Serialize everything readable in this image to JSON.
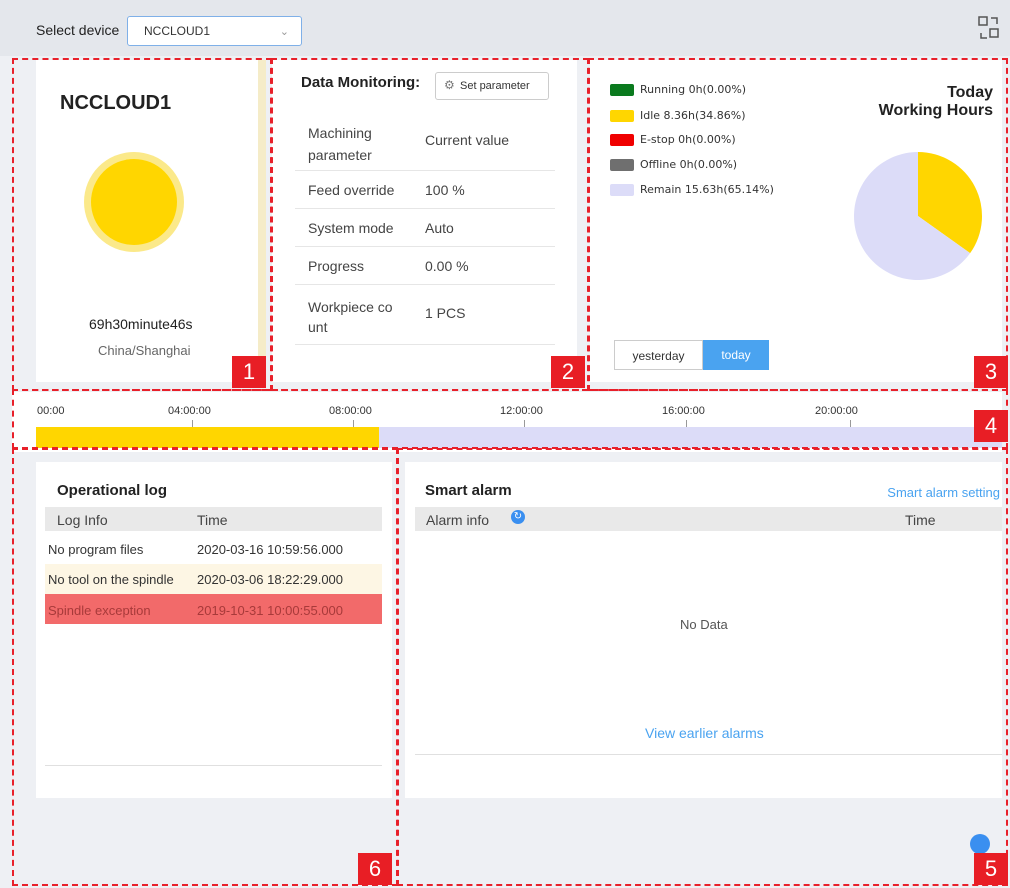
{
  "toolbar": {
    "select_label": "Select device",
    "device_value": "NCCLOUD1",
    "chevron_icon": "chevron-down-icon",
    "switch_icon": "layout-switch-icon"
  },
  "device_panel": {
    "name": "NCCLOUD1",
    "status_color": "#ffd600",
    "runtime": "69h30minute46s",
    "location": "China/Shanghai"
  },
  "data_monitoring": {
    "title": "Data Monitoring:",
    "set_button": "Set parameter",
    "header": {
      "param": "Machining parameter",
      "value": "Current value"
    },
    "rows": [
      {
        "param": "Feed override",
        "value": "100 %"
      },
      {
        "param": "System mode",
        "value": "Auto"
      },
      {
        "param": "Progress",
        "value": "0.00 %"
      },
      {
        "param": "Workpiece count",
        "value": "1 PCS"
      }
    ]
  },
  "working_hours": {
    "title": "Today Working Hours",
    "legend": [
      {
        "label": "Running 0h(0.00%)",
        "color": "#0a7a1e"
      },
      {
        "label": "Idle 8.36h(34.86%)",
        "color": "#ffd600"
      },
      {
        "label": "E-stop 0h(0.00%)",
        "color": "#f00000"
      },
      {
        "label": "Offline 0h(0.00%)",
        "color": "#6f6f6f"
      },
      {
        "label": "Remain 15.63h(65.14%)",
        "color": "#dcdcf8"
      }
    ],
    "tabs": {
      "yesterday": "yesterday",
      "today": "today"
    },
    "active_tab": "today"
  },
  "chart_data": {
    "type": "pie",
    "title": "Today Working Hours",
    "categories": [
      "Running",
      "Idle",
      "E-stop",
      "Offline",
      "Remain"
    ],
    "values": [
      0.0,
      34.86,
      0.0,
      0.0,
      65.14
    ],
    "hours": [
      0,
      8.36,
      0,
      0,
      15.63
    ],
    "colors": [
      "#0a7a1e",
      "#ffd600",
      "#f00000",
      "#6f6f6f",
      "#dcdcf8"
    ]
  },
  "timeline": {
    "labels": [
      "00:00",
      "04:00:00",
      "08:00:00",
      "12:00:00",
      "16:00:00",
      "20:00:00"
    ],
    "idle_color": "#ffd600",
    "remain_color": "#dcdcf8"
  },
  "operational_log": {
    "title": "Operational log",
    "columns": [
      "Log Info",
      "Time"
    ],
    "rows": [
      {
        "info": "No program files",
        "time": "2020-03-16 10:59:56.000"
      },
      {
        "info": "No tool on the spindle",
        "time": "2020-03-06 18:22:29.000"
      },
      {
        "info": "Spindle exception",
        "time": "2019-10-31 10:00:55.000"
      }
    ]
  },
  "smart_alarm": {
    "title": "Smart alarm",
    "setting_link": "Smart alarm setting",
    "columns": [
      "Alarm info",
      "Time"
    ],
    "empty_text": "No Data",
    "earlier_link": "View earlier alarms"
  },
  "markers": [
    "1",
    "2",
    "3",
    "4",
    "5",
    "6"
  ]
}
